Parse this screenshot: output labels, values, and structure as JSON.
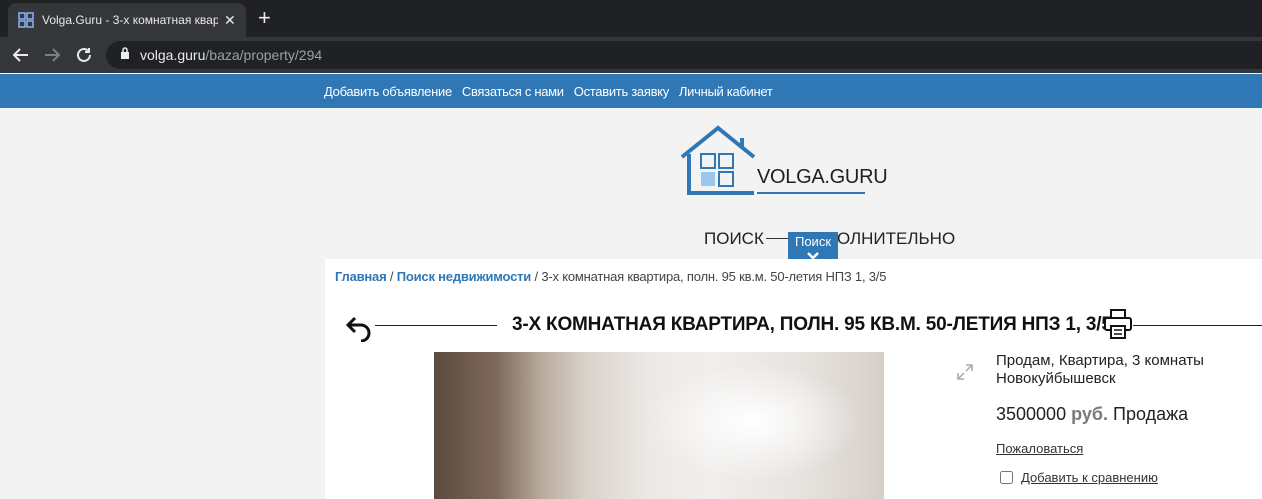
{
  "browser": {
    "tab_title": "Volga.Guru - 3-х комнатная квар",
    "url_host": "volga.guru",
    "url_path": "/baza/property/294"
  },
  "sitenav": {
    "items": [
      "Добавить объявление",
      "Связаться с нами",
      "Оставить заявку",
      "Личный кабинет"
    ]
  },
  "logo": {
    "text": "VOLGA.GURU"
  },
  "search_menu": {
    "search": "ПОИСК",
    "advanced": "ДОПОЛНИТЕЛЬНО",
    "toggle_label": "Поиск"
  },
  "breadcrumb": {
    "home": "Главная",
    "separator": " / ",
    "search": "Поиск недвижимости",
    "current": "3-х комнатная квартира, полн. 95 кв.м. 50-летия НПЗ 1, 3/5"
  },
  "listing": {
    "title": "3-Х КОМНАТНАЯ КВАРТИРА, ПОЛН. 95 КВ.М. 50-ЛЕТИЯ НПЗ 1, 3/5",
    "type_line": "Продам, Квартира, 3 комнаты",
    "city": "Новокуйбышевск",
    "price": "3500000",
    "currency": "руб.",
    "deal": "Продажа",
    "complain": "Пожаловаться",
    "compare": "Добавить к сравнению"
  },
  "colors": {
    "brand": "#3077b5",
    "chrome_dark": "#202124",
    "chrome_mid": "#35363a"
  }
}
